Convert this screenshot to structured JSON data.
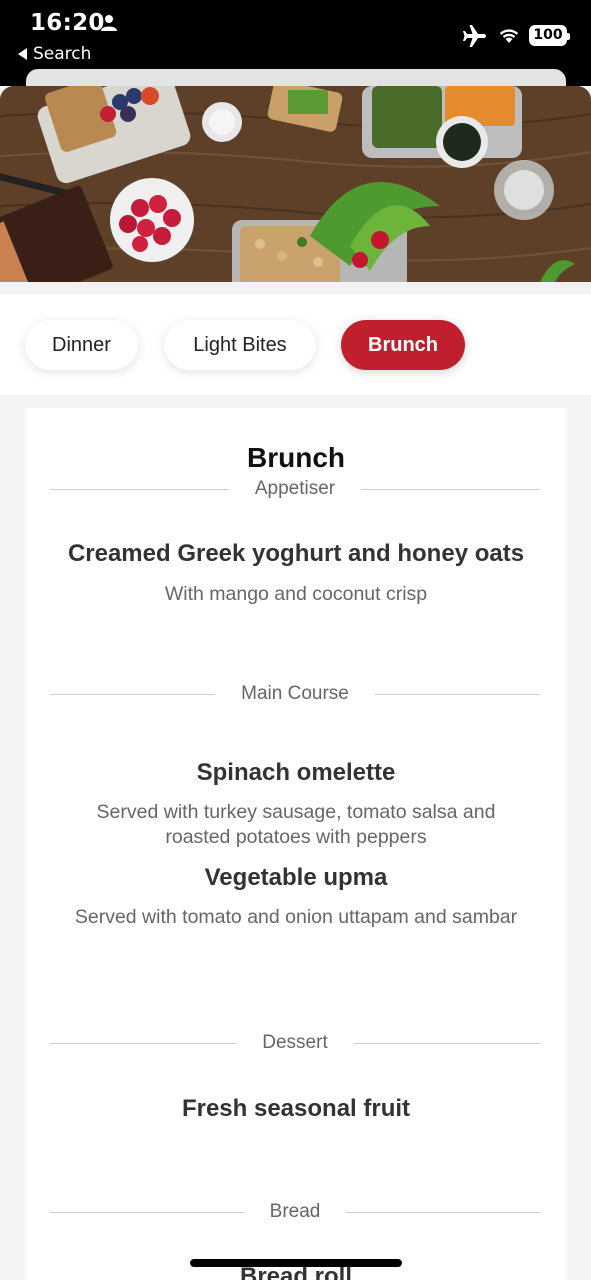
{
  "status_bar": {
    "time": "16:20",
    "back_label": "Search",
    "battery": "100"
  },
  "tabs": [
    {
      "label": "Dinner",
      "active": false
    },
    {
      "label": "Light Bites",
      "active": false
    },
    {
      "label": "Brunch",
      "active": true
    }
  ],
  "menu": {
    "title": "Brunch",
    "sections": [
      {
        "name": "Appetiser",
        "items": [
          {
            "name": "Creamed Greek yoghurt and honey oats",
            "description": "With mango and coconut crisp"
          }
        ]
      },
      {
        "name": "Main Course",
        "items": [
          {
            "name": "Spinach omelette",
            "description": "Served with turkey sausage, tomato salsa and roasted potatoes with peppers"
          },
          {
            "name": "Vegetable upma",
            "description": "Served with tomato and onion uttapam and sambar"
          }
        ]
      },
      {
        "name": "Dessert",
        "items": [
          {
            "name": "Fresh seasonal fruit",
            "description": ""
          }
        ]
      },
      {
        "name": "Bread",
        "items": [
          {
            "name": "Bread roll",
            "description": ""
          }
        ]
      }
    ]
  },
  "colors": {
    "accent": "#c0202d",
    "background": "#f4f4f4"
  }
}
